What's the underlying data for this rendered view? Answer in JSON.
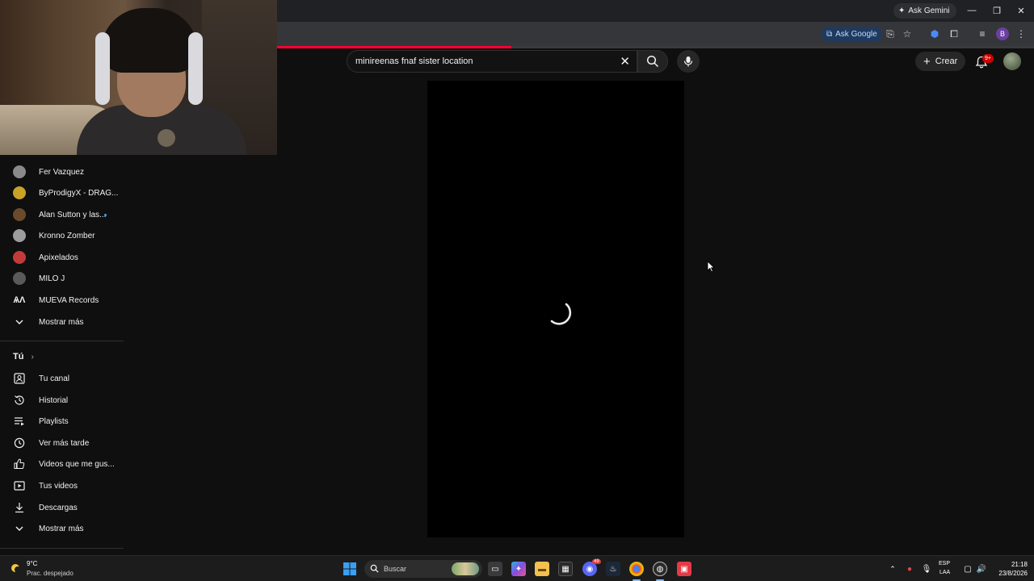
{
  "browser": {
    "gemini_label": "Ask Gemini",
    "ask_google_label": "Ask Google",
    "profile_letter": "B",
    "loading_progress": 0.31
  },
  "youtube": {
    "search": {
      "value": "minireenas fnaf sister location"
    },
    "create_label": "Crear",
    "notifications_badge": "9+"
  },
  "sidebar": {
    "subscriptions": [
      {
        "label": "Fer Vazquez",
        "avatar_color": "#8a8a8a",
        "live": false
      },
      {
        "label": "ByProdigyX - DRAG...",
        "avatar_color": "#c9a227",
        "live": false
      },
      {
        "label": "Alan Sutton y las...",
        "avatar_color": "#6b4a2b",
        "live": true
      },
      {
        "label": "Kronno Zomber",
        "avatar_color": "#9d9d9d",
        "live": false
      },
      {
        "label": "Apixelados",
        "avatar_color": "#c23b3b",
        "live": false
      },
      {
        "label": "MILO J",
        "avatar_color": "#5a5a5a",
        "live": false
      },
      {
        "label": "MUEVA Records",
        "avatar_color": "#0f0f0f",
        "live": false
      }
    ],
    "show_more_1": "Mostrar más",
    "you_section": "Tú",
    "you_items": [
      {
        "label": "Tu canal",
        "icon": "channel-icon"
      },
      {
        "label": "Historial",
        "icon": "history-icon"
      },
      {
        "label": "Playlists",
        "icon": "playlists-icon"
      },
      {
        "label": "Ver más tarde",
        "icon": "watch-later-icon"
      },
      {
        "label": "Videos que me gus...",
        "icon": "like-icon"
      },
      {
        "label": "Tus videos",
        "icon": "your-videos-icon"
      },
      {
        "label": "Descargas",
        "icon": "download-icon"
      }
    ],
    "show_more_2": "Mostrar más"
  },
  "taskbar": {
    "weather_temp": "9°C",
    "weather_desc": "Prac. despejado",
    "search_placeholder": "Buscar",
    "lang_top": "ESP",
    "lang_bottom": "LAA",
    "time": "21:18",
    "date": "23/8/2026",
    "discord_badge": "49"
  }
}
